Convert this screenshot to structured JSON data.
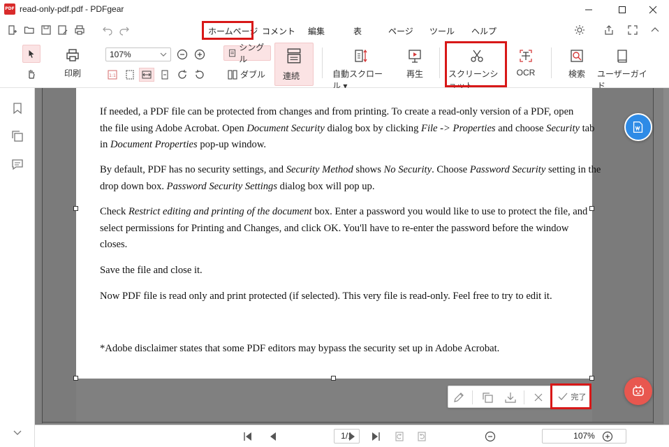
{
  "window": {
    "title": "read-only-pdf.pdf - PDFgear",
    "logo_text": "PDF"
  },
  "menu": {
    "tabs": [
      "ホームページ",
      "コメント",
      "編集",
      "表",
      "ページ",
      "ツール",
      "ヘルプ"
    ],
    "active_tab": "ホームページ"
  },
  "toolbar": {
    "print_label": "印刷",
    "zoom_value": "107%",
    "single_label": "シングル",
    "double_label": "ダブル",
    "continuous_label": "連続",
    "autoscroll_label": "自動スクロール",
    "play_label": "再生",
    "screenshot_label": "スクリーンショット",
    "ocr_label": "OCR",
    "search_label": "検索",
    "guide_label": "ユーザーガイド"
  },
  "document": {
    "p1": [
      "If needed, a PDF file can be protected from changes and from printing. To create a read-only version of a PDF, open",
      "the file using Adobe Acrobat. Open ",
      "Document Security",
      " dialog box by clicking ",
      "File -> Properties",
      " and choose ",
      "Security",
      " tab",
      "in ",
      "Document Properties",
      " pop-up window."
    ],
    "p2": [
      "By default, PDF has no security settings, and ",
      "Security Method",
      " shows ",
      "No Security",
      ". Choose ",
      "Password Security",
      " setting in the",
      "drop down box. ",
      "Password Security Settings",
      " dialog box will pop up."
    ],
    "p3": [
      "Check ",
      "Restrict editing and printing of the document",
      " box. Enter a password you would like to use to protect the file, and",
      "select permissions for Printing and Changes, and click OK. You'll have to re-enter the password before the window",
      "closes."
    ],
    "p4": "Save the file and close it.",
    "p5": "Now PDF file is read only and print protected (if selected). This very file is read-only. Feel free to try to edit it.",
    "p6": "*Adobe disclaimer states that some PDF editors may bypass the security set up in Adobe Acrobat."
  },
  "floatbar": {
    "done_label": "完了"
  },
  "status": {
    "page": "1/1",
    "zoom": "107%"
  },
  "colors": {
    "highlight": "#d81818",
    "accent_pink": "#fbe3e4",
    "fab_blue": "#2e8be6",
    "fab_red": "#e8574f"
  }
}
